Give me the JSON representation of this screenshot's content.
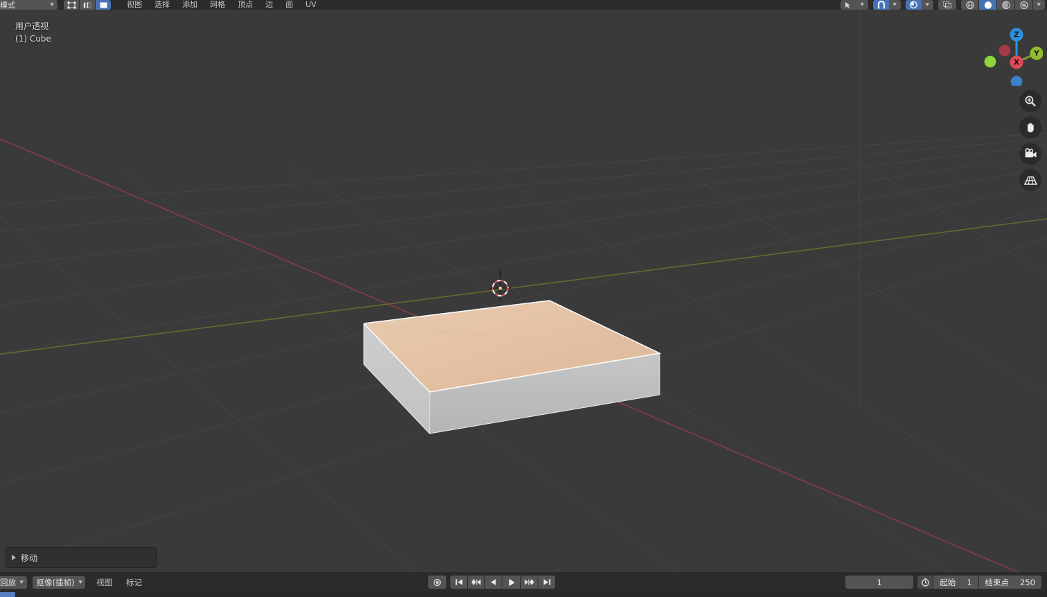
{
  "app": {
    "name": "Blender",
    "mode": "edit-mode"
  },
  "colors": {
    "viewport_bg": "#3a3a3a",
    "header_bg": "#2b2b2b",
    "widget_bg": "#545454",
    "accent_blue": "#4772b3",
    "playhead_blue": "#5680c2",
    "axis_x_red": "#8b3c4c",
    "axis_y_green": "#6b6b33",
    "grid_line": "#4a4a4a",
    "face_selected": "#e5c3a6",
    "mesh_gray": "#b9b9b9",
    "gizmo_z": "#2f8fe0",
    "gizmo_y": "#8fbf2f",
    "gizmo_x": "#e04a58"
  },
  "header": {
    "mode_selector": {
      "label": "模式",
      "chevron": "chevron-down-icon"
    },
    "select_modes": [
      {
        "name": "vertex-select-mode",
        "icon": "vertex-icon",
        "active": false
      },
      {
        "name": "edge-select-mode",
        "icon": "edge-icon",
        "active": false
      },
      {
        "name": "face-select-mode",
        "icon": "face-icon",
        "active": true
      }
    ],
    "menus": [
      {
        "label": "视图"
      },
      {
        "label": "选择"
      },
      {
        "label": "添加"
      },
      {
        "label": "网格"
      },
      {
        "label": "顶点"
      },
      {
        "label": "边"
      },
      {
        "label": "面"
      },
      {
        "label": "UV"
      }
    ],
    "right_toggles": [
      {
        "name": "select-visibility-toggle",
        "icon": "cursor-select-icon",
        "active": false,
        "has_dropdown": true
      },
      {
        "name": "snap-toggle",
        "icon": "magnet-icon",
        "active": true,
        "has_dropdown": true
      },
      {
        "name": "proportional-editing-toggle",
        "icon": "proportional-icon",
        "active": true,
        "has_dropdown": true
      }
    ],
    "overlays_button": {
      "name": "show-overlays",
      "icon": "overlay-icon",
      "active": false
    },
    "shading_modes": [
      {
        "label": "wireframe",
        "icon": "wireframe-sphere-icon",
        "active": false
      },
      {
        "label": "solid",
        "icon": "solid-sphere-icon",
        "active": true
      },
      {
        "label": "material",
        "icon": "material-sphere-icon",
        "active": false
      },
      {
        "label": "rendered",
        "icon": "rendered-sphere-icon",
        "active": false
      }
    ],
    "shading_dropdown": {
      "name": "shading-options",
      "icon": "chevron-down-icon"
    }
  },
  "viewport": {
    "view_label": "用户透视",
    "object_label": "(1) Cube",
    "gizmo": {
      "axes": [
        {
          "label": "Z",
          "color": "#2f8fe0"
        },
        {
          "label": "Y",
          "color": "#8fbf2f"
        },
        {
          "label": "X",
          "color": "#e04a58"
        }
      ]
    },
    "tools": [
      {
        "name": "zoom-tool",
        "icon": "magnifier-plus-icon"
      },
      {
        "name": "pan-tool",
        "icon": "hand-icon"
      },
      {
        "name": "camera-view-tool",
        "icon": "camera-icon"
      },
      {
        "name": "toggle-orthographic-tool",
        "icon": "grid-perspective-icon"
      }
    ],
    "operator_panel": {
      "label": "移动",
      "expander": "triangle-right-icon",
      "expanded": false
    }
  },
  "timeline": {
    "menus": [
      {
        "label": "回放",
        "type": "dropdown",
        "chevron": "chevron-down-icon"
      },
      {
        "label": "抠像(插帧)",
        "type": "dropdown",
        "chevron": "chevron-down-icon"
      },
      {
        "label": "视图",
        "type": "menu"
      },
      {
        "label": "标记",
        "type": "menu"
      }
    ],
    "transport": [
      {
        "name": "auto-keying-button",
        "icon": "record-dot-icon"
      },
      {
        "name": "jump-to-start-button",
        "icon": "skip-to-start-icon"
      },
      {
        "name": "previous-keyframe-button",
        "icon": "prev-keyframe-icon"
      },
      {
        "name": "play-reverse-button",
        "icon": "play-reverse-icon"
      },
      {
        "name": "play-button",
        "icon": "play-icon"
      },
      {
        "name": "next-keyframe-button",
        "icon": "next-keyframe-icon"
      },
      {
        "name": "jump-to-end-button",
        "icon": "skip-to-end-icon"
      }
    ],
    "current_frame": "1",
    "use_preview_range_icon": "stopwatch-icon",
    "start": {
      "label": "起始",
      "value": "1"
    },
    "end": {
      "label": "结束点",
      "value": "250"
    }
  }
}
